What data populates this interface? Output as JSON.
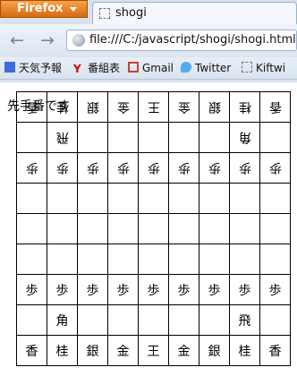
{
  "browser": {
    "app_button": "Firefox",
    "tab_title": "shogi",
    "url": "file:///C:/javascript/shogi/shogi.html"
  },
  "bookmarks": [
    {
      "label": "天気予報",
      "icon": "flag-icon",
      "color": "#3a6dd8"
    },
    {
      "label": "番組表",
      "icon": "y-icon",
      "color": "#d40000"
    },
    {
      "label": "Gmail",
      "icon": "gmail-icon",
      "color": "#c84132"
    },
    {
      "label": "Twitter",
      "icon": "twitter-bird-icon",
      "color": "#55acee"
    },
    {
      "label": "Kiftwi",
      "icon": "page-icon",
      "color": "#777777"
    }
  ],
  "game": {
    "status": "先手番です",
    "board": [
      [
        "香",
        "桂",
        "銀",
        "金",
        "王",
        "金",
        "銀",
        "桂",
        "香"
      ],
      [
        "",
        "飛",
        "",
        "",
        "",
        "",
        "",
        "角",
        ""
      ],
      [
        "歩",
        "歩",
        "歩",
        "歩",
        "歩",
        "歩",
        "歩",
        "歩",
        "歩"
      ],
      [
        "",
        "",
        "",
        "",
        "",
        "",
        "",
        "",
        ""
      ],
      [
        "",
        "",
        "",
        "",
        "",
        "",
        "",
        "",
        ""
      ],
      [
        "",
        "",
        "",
        "",
        "",
        "",
        "",
        "",
        ""
      ],
      [
        "歩",
        "歩",
        "歩",
        "歩",
        "歩",
        "歩",
        "歩",
        "歩",
        "歩"
      ],
      [
        "",
        "角",
        "",
        "",
        "",
        "",
        "",
        "飛",
        ""
      ],
      [
        "香",
        "桂",
        "銀",
        "金",
        "王",
        "金",
        "銀",
        "桂",
        "香"
      ]
    ],
    "gote_rows": [
      0,
      1,
      2
    ]
  }
}
